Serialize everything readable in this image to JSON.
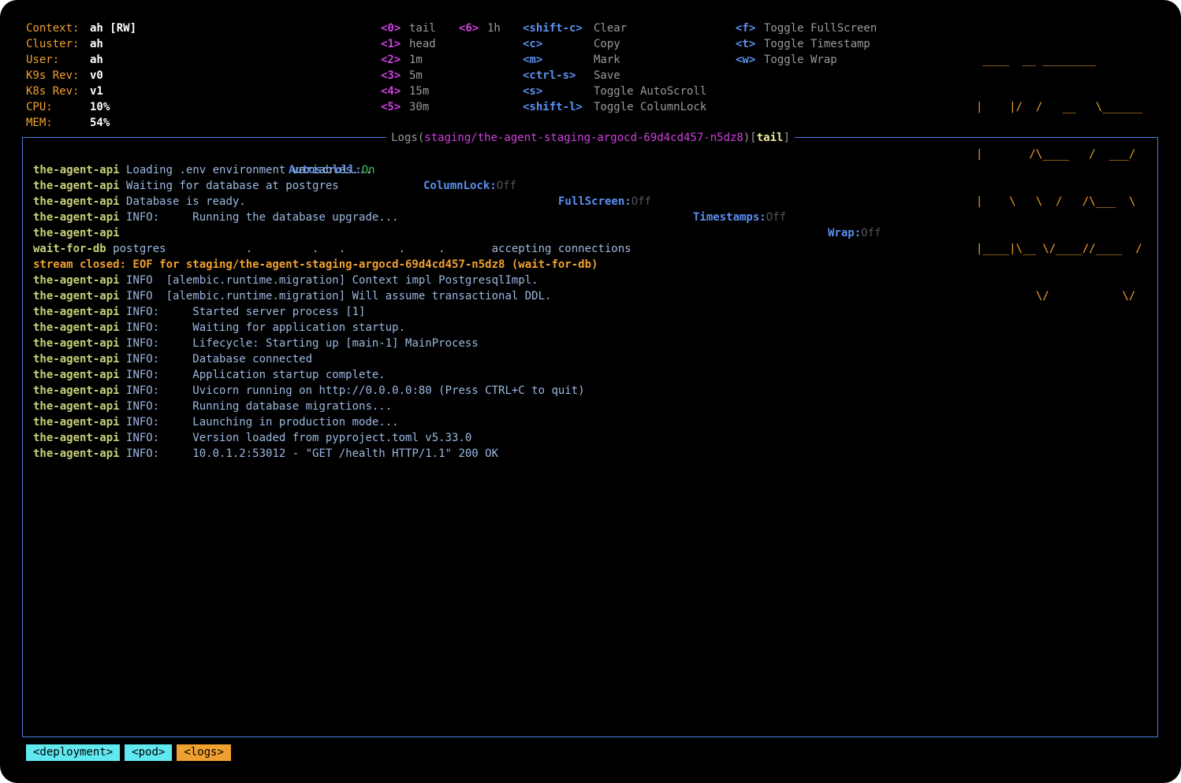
{
  "header": {
    "info": [
      {
        "label": "Context:",
        "value": "ah [RW]"
      },
      {
        "label": "Cluster:",
        "value": "ah"
      },
      {
        "label": "User:",
        "value": "ah"
      },
      {
        "label": "K9s Rev:",
        "value": "v0"
      },
      {
        "label": "K8s Rev:",
        "value": "v1"
      },
      {
        "label": "CPU:",
        "value": "10%"
      },
      {
        "label": "MEM:",
        "value": "54%"
      }
    ],
    "time_keys": [
      {
        "key": "<0>",
        "label": "tail"
      },
      {
        "key": "<1>",
        "label": "head"
      },
      {
        "key": "<2>",
        "label": "1m"
      },
      {
        "key": "<3>",
        "label": "5m"
      },
      {
        "key": "<4>",
        "label": "15m"
      },
      {
        "key": "<5>",
        "label": "30m"
      },
      {
        "key": "<6>",
        "label": "1h"
      }
    ],
    "action_keys": [
      {
        "key": "<shift-c>",
        "label": "Clear"
      },
      {
        "key": "<c>",
        "label": "Copy"
      },
      {
        "key": "<m>",
        "label": "Mark"
      },
      {
        "key": "<ctrl-s>",
        "label": "Save"
      },
      {
        "key": "<s>",
        "label": "Toggle AutoScroll"
      },
      {
        "key": "<shift-l>",
        "label": "Toggle ColumnLock"
      }
    ],
    "toggle_keys": [
      {
        "key": "<f>",
        "label": "Toggle FullScreen"
      },
      {
        "key": "<t>",
        "label": "Toggle Timestamp"
      },
      {
        "key": "<w>",
        "label": "Toggle Wrap"
      }
    ],
    "logo_lines": [
      " ____  __ ________       ",
      "|    |/  /   __   \\______ ",
      "|       /\\____   /  ___/ ",
      "|    \\   \\  /   /\\___  \\ ",
      "|____|\\__ \\/____//____  / ",
      "         \\/           \\/  "
    ]
  },
  "panel": {
    "title_prefix": "Logs(",
    "title_path": "staging/the-agent-staging-argocd-69d4cd457-n5dz8",
    "title_mid": ")[",
    "title_mode": "tail",
    "title_suffix": "]"
  },
  "status": [
    {
      "label": "Autoscroll:",
      "value": "On",
      "on": true
    },
    {
      "label": "ColumnLock:",
      "value": "Off",
      "on": false
    },
    {
      "label": "FullScreen:",
      "value": "Off",
      "on": false
    },
    {
      "label": "Timestamps:",
      "value": "Off",
      "on": false
    },
    {
      "label": "Wrap:",
      "value": "Off",
      "on": false
    }
  ],
  "logs": [
    {
      "src": "the-agent-api",
      "msg": "Loading .env environment variables..."
    },
    {
      "src": "the-agent-api",
      "msg": "Waiting for database at postgres"
    },
    {
      "src": "the-agent-api",
      "msg": "Database is ready."
    },
    {
      "src": "the-agent-api",
      "msg": "INFO:     Running the database upgrade..."
    },
    {
      "src": "the-agent-api",
      "msg": ""
    },
    {
      "src": "wait-for-db",
      "msg": "postgres            .         .   .        .     .       accepting connections"
    },
    {
      "src": "",
      "msg": "stream closed: EOF for staging/the-agent-staging-argocd-69d4cd457-n5dz8 (wait-for-db)",
      "error": true
    },
    {
      "src": "the-agent-api",
      "msg": "INFO  [alembic.runtime.migration] Context impl PostgresqlImpl."
    },
    {
      "src": "the-agent-api",
      "msg": "INFO  [alembic.runtime.migration] Will assume transactional DDL."
    },
    {
      "src": "the-agent-api",
      "msg": "INFO:     Started server process [1]"
    },
    {
      "src": "the-agent-api",
      "msg": "INFO:     Waiting for application startup."
    },
    {
      "src": "the-agent-api",
      "msg": "INFO:     Lifecycle: Starting up [main-1] MainProcess"
    },
    {
      "src": "the-agent-api",
      "msg": "INFO:     Database connected"
    },
    {
      "src": "the-agent-api",
      "msg": "INFO:     Application startup complete."
    },
    {
      "src": "the-agent-api",
      "msg": "INFO:     Uvicorn running on http://0.0.0.0:80 (Press CTRL+C to quit)"
    },
    {
      "src": "the-agent-api",
      "msg": "INFO:     Running database migrations..."
    },
    {
      "src": "the-agent-api",
      "msg": "INFO:     Launching in production mode..."
    },
    {
      "src": "the-agent-api",
      "msg": "INFO:     Version loaded from pyproject.toml v5.33.0"
    },
    {
      "src": "the-agent-api",
      "msg": "INFO:     10.0.1.2:53012 - \"GET /health HTTP/1.1\" 200 OK"
    }
  ],
  "breadcrumbs": [
    {
      "label": "<deployment>",
      "active": false
    },
    {
      "label": "<pod>",
      "active": false
    },
    {
      "label": "<logs>",
      "active": true
    }
  ],
  "colors": {
    "accent": "#f0a030",
    "key": "#5a8ff0",
    "border": "#4a7fe0",
    "crumb": "#60e8f0"
  }
}
